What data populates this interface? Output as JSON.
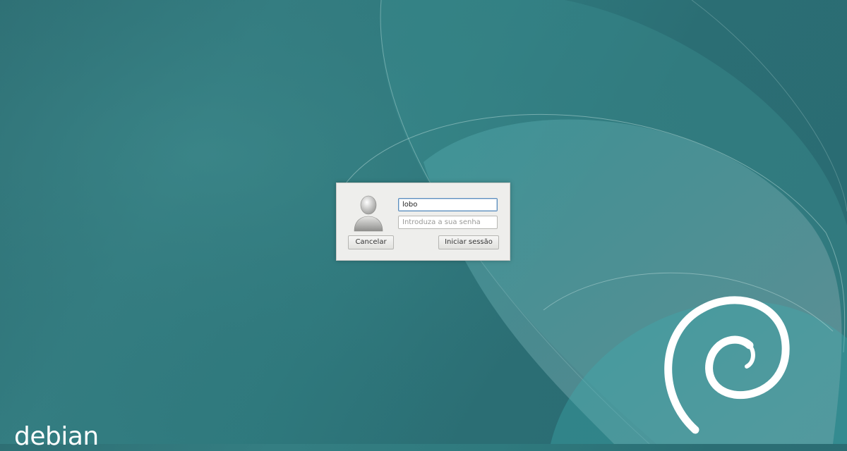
{
  "login": {
    "username_value": "lobo",
    "password_placeholder": "Introduza a sua senha",
    "cancel_label": "Cancelar",
    "login_label": "Iniciar sessão",
    "avatar_icon": "user-avatar-icon"
  },
  "branding": {
    "text": "debian",
    "logo_icon": "debian-swirl-icon"
  },
  "colors": {
    "background": "#2e7276",
    "dialog": "#eeeeec",
    "focus": "#5a8dbe"
  }
}
